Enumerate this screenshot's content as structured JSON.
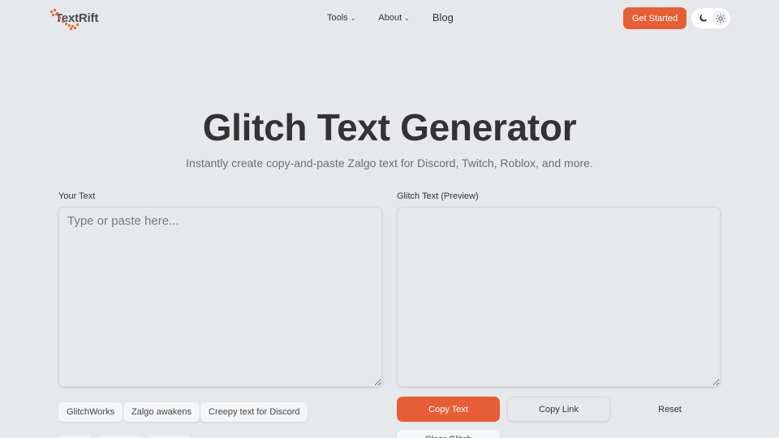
{
  "brand": {
    "name": "TextRift",
    "accent": "#e55e35"
  },
  "nav": {
    "tools": "Tools",
    "about": "About",
    "blog": "Blog",
    "cta": "Get Started"
  },
  "theme": {
    "dark_icon": "moon-icon",
    "light_icon": "sun-icon"
  },
  "hero": {
    "title": "Glitch Text Generator",
    "subtitle": "Instantly create copy-and-paste Zalgo text for Discord, Twitch, Roblox, and more."
  },
  "editor": {
    "input_label": "Your Text",
    "input_placeholder": "Type or paste here...",
    "input_value": "",
    "output_label": "Glitch Text (Preview)",
    "output_value": ""
  },
  "examples": [
    "GlitchWorks",
    "Zalgo awakens",
    "Creepy text for Discord"
  ],
  "actions": {
    "copy_text": "Copy Text",
    "copy_link": "Copy Link",
    "reset": "Reset",
    "clear_glitch": "Clear Glitch"
  }
}
